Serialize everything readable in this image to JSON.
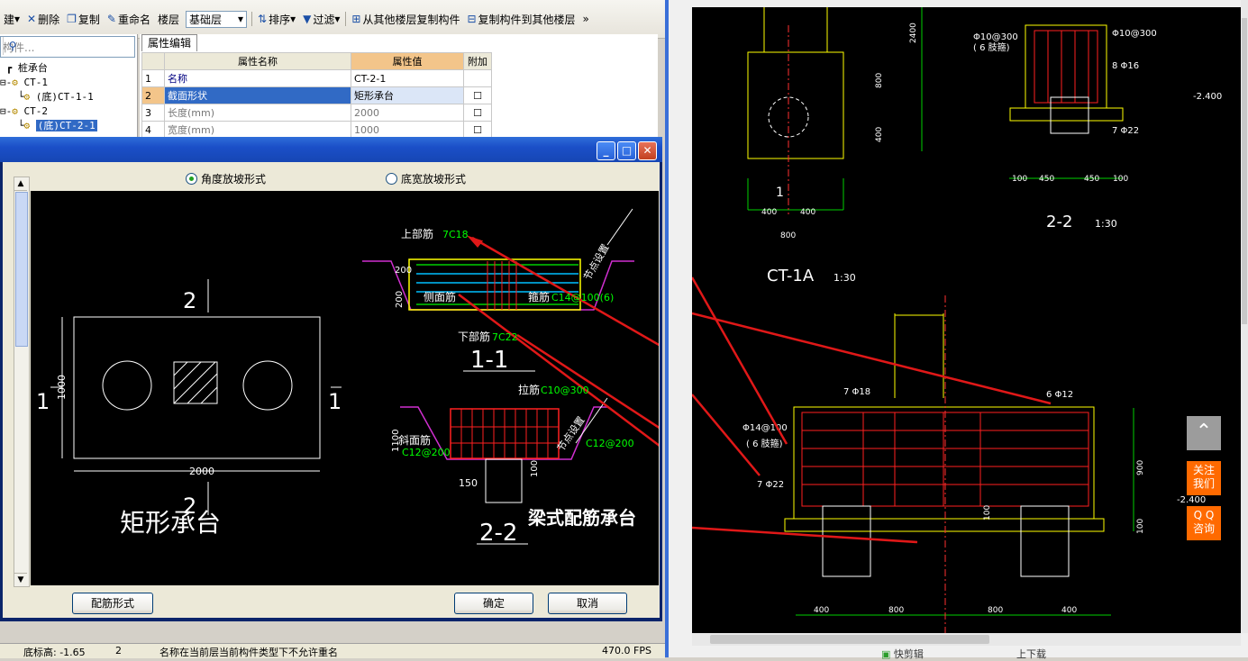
{
  "toolbar": {
    "items": [
      "建",
      "删除",
      "复制",
      "重命名",
      "楼层"
    ],
    "floor_value": "基础层",
    "sort": "排序",
    "filter": "过滤",
    "copy_from": "从其他楼层复制构件",
    "copy_to": "复制构件到其他楼层",
    "more": "»"
  },
  "search": {
    "placeholder": "构件..."
  },
  "tree": {
    "root": "桩承台",
    "n1": "CT-1",
    "n1c": "(底)CT-1-1",
    "n2": "CT-2",
    "n2c": "(底)CT-2-1"
  },
  "props": {
    "tab": "属性编辑",
    "col_name": "属性名称",
    "col_value": "属性值",
    "col_extra": "附加",
    "rows": [
      {
        "n": "1",
        "name": "名称",
        "value": "CT-2-1"
      },
      {
        "n": "2",
        "name": "截面形状",
        "value": "矩形承台"
      },
      {
        "n": "3",
        "name": "长度(mm)",
        "value": "2000"
      },
      {
        "n": "4",
        "name": "宽度(mm)",
        "value": "1000"
      }
    ]
  },
  "dialog": {
    "radio1": "角度放坡形式",
    "radio2": "底宽放坡形式",
    "btn_rebar": "配筋形式",
    "btn_ok": "确定",
    "btn_cancel": "取消"
  },
  "drawing": {
    "plan_title": "矩形承台",
    "sec_mark_2": "2",
    "sec_mark_1": "1",
    "dim_1000": "1000",
    "dim_2000": "2000",
    "top_rebar_label": "上部筋",
    "top_rebar_val": "7C18",
    "side_rebar_label": "侧面筋",
    "stirrup_label": "箍筋",
    "stirrup_val": "C14@100(6)",
    "bottom_rebar_label": "下部筋",
    "bottom_rebar_val": "7C22",
    "tie_label": "拉筋",
    "tie_val": "C10@300",
    "node_setting": "节点设置",
    "dim_200": "200",
    "dim_100": "100",
    "dim_150": "150",
    "dim_1100": "1100",
    "slope_label": "斜面筋",
    "slope_val": "C12@200",
    "slope_val2": "C12@200",
    "sec11": "1-1",
    "sec22": "2-2",
    "beam_type": "梁式配筋承台"
  },
  "status": {
    "a": "底标高: -1.65",
    "b": "2",
    "c": "名称在当前层当前构件类型下不允许重名",
    "d": "470.0 FPS"
  },
  "cad": {
    "ct1a": "CT-1A",
    "scale1": "1:30",
    "sec22": "2-2",
    "scale2": "1:30",
    "r_top": "Φ10@300",
    "r_mid": "8 Φ16",
    "r_bot": "7 Φ22",
    "r_left": "Φ10@100",
    "r_left2": "( 6 肢箍)",
    "elev1": "-2.400",
    "d100a": "100",
    "d450a": "450",
    "d450b": "450",
    "d100b": "100",
    "d400a": "400",
    "d400b": "400",
    "d800": "800",
    "d2400": "2400",
    "d400c": "400",
    "d800b": "800",
    "one": "1",
    "b_top": "7 Φ18",
    "b_side": "6 Φ12",
    "b_stir": "Φ14@100",
    "b_stir2": "( 6 肢箍)",
    "b_bot": "7 Φ22",
    "b_900": "900",
    "b_100": "100",
    "b_elev": "-2.400",
    "b_400a": "400",
    "b_800a": "800",
    "b_800b": "800",
    "b_400b": "400",
    "b_100v": "100"
  },
  "side": {
    "top_icon": "arrow-up-icon",
    "follow1": "关注",
    "follow2": "我们",
    "qq1": "Q Q",
    "qq2": "咨询"
  },
  "bottom_right": {
    "a": "快剪辑",
    "b": "上下载"
  }
}
